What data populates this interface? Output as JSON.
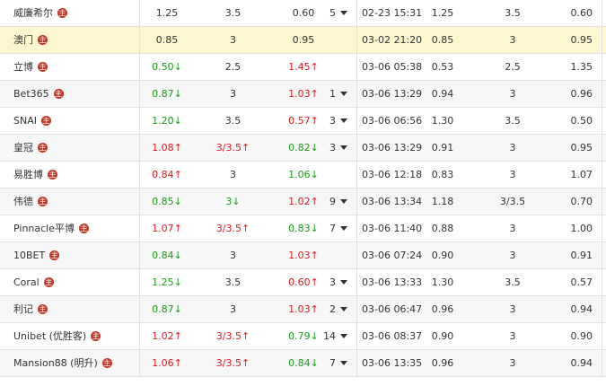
{
  "rows": [
    {
      "name": "威廉希尔",
      "o1": "1.25",
      "o1_dir": "neutral",
      "o2": "3.5",
      "o2_dir": "neutral",
      "o3": "0.60",
      "o3_dir": "neutral",
      "changes": "5",
      "time": "02-23 15:31",
      "n1": "1.25",
      "n2": "3.5",
      "n3": "0.60",
      "style": "normal"
    },
    {
      "name": "澳门",
      "o1": "0.85",
      "o1_dir": "neutral",
      "o2": "3",
      "o2_dir": "neutral",
      "o3": "0.95",
      "o3_dir": "neutral",
      "changes": "",
      "time": "03-02 21:20",
      "n1": "0.85",
      "n2": "3",
      "n3": "0.95",
      "style": "highlight"
    },
    {
      "name": "立博",
      "o1": "0.50↓",
      "o1_dir": "down",
      "o2": "2.5",
      "o2_dir": "neutral",
      "o3": "1.45↑",
      "o3_dir": "up",
      "changes": "",
      "time": "03-06 05:38",
      "n1": "0.53",
      "n2": "2.5",
      "n3": "1.35",
      "style": "normal"
    },
    {
      "name": "Bet365",
      "o1": "0.87↓",
      "o1_dir": "down",
      "o2": "3",
      "o2_dir": "neutral",
      "o3": "1.03↑",
      "o3_dir": "up",
      "changes": "1",
      "time": "03-06 13:29",
      "n1": "0.94",
      "n2": "3",
      "n3": "0.96",
      "style": "alt"
    },
    {
      "name": "SNAI",
      "o1": "1.20↓",
      "o1_dir": "down",
      "o2": "3.5",
      "o2_dir": "neutral",
      "o3": "0.57↑",
      "o3_dir": "up",
      "changes": "3",
      "time": "03-06 06:56",
      "n1": "1.30",
      "n2": "3.5",
      "n3": "0.50",
      "style": "normal"
    },
    {
      "name": "皇冠",
      "o1": "1.08↑",
      "o1_dir": "up",
      "o2": "3/3.5↑",
      "o2_dir": "up",
      "o3": "0.82↓",
      "o3_dir": "down",
      "changes": "3",
      "time": "03-06 13:29",
      "n1": "0.91",
      "n2": "3",
      "n3": "0.95",
      "style": "alt"
    },
    {
      "name": "易胜博",
      "o1": "0.84↑",
      "o1_dir": "up",
      "o2": "3",
      "o2_dir": "neutral",
      "o3": "1.06↓",
      "o3_dir": "down",
      "changes": "",
      "time": "03-06 12:18",
      "n1": "0.83",
      "n2": "3",
      "n3": "1.07",
      "style": "normal"
    },
    {
      "name": "伟德",
      "o1": "0.85↓",
      "o1_dir": "down",
      "o2": "3↓",
      "o2_dir": "down",
      "o3": "1.02↑",
      "o3_dir": "up",
      "changes": "9",
      "time": "03-06 13:34",
      "n1": "1.18",
      "n2": "3/3.5",
      "n3": "0.70",
      "style": "alt"
    },
    {
      "name": "Pinnacle平博",
      "o1": "1.07↑",
      "o1_dir": "up",
      "o2": "3/3.5↑",
      "o2_dir": "up",
      "o3": "0.83↓",
      "o3_dir": "down",
      "changes": "7",
      "time": "03-06 11:40",
      "n1": "0.88",
      "n2": "3",
      "n3": "1.00",
      "style": "normal"
    },
    {
      "name": "10BET",
      "o1": "0.84↓",
      "o1_dir": "down",
      "o2": "3",
      "o2_dir": "neutral",
      "o3": "1.03↑",
      "o3_dir": "up",
      "changes": "",
      "time": "03-06 07:24",
      "n1": "0.90",
      "n2": "3",
      "n3": "0.91",
      "style": "alt"
    },
    {
      "name": "Coral",
      "o1": "1.25↓",
      "o1_dir": "down",
      "o2": "3.5",
      "o2_dir": "neutral",
      "o3": "0.60↑",
      "o3_dir": "up",
      "changes": "3",
      "time": "03-06 13:33",
      "n1": "1.30",
      "n2": "3.5",
      "n3": "0.57",
      "style": "normal"
    },
    {
      "name": "利记",
      "o1": "0.87↓",
      "o1_dir": "down",
      "o2": "3",
      "o2_dir": "neutral",
      "o3": "1.03↑",
      "o3_dir": "up",
      "changes": "2",
      "time": "03-06 06:47",
      "n1": "0.96",
      "n2": "3",
      "n3": "0.94",
      "style": "alt"
    },
    {
      "name": "Unibet (优胜客)",
      "o1": "1.02↑",
      "o1_dir": "up",
      "o2": "3/3.5↑",
      "o2_dir": "up",
      "o3": "0.79↓",
      "o3_dir": "down",
      "changes": "14",
      "time": "03-06 08:37",
      "n1": "0.90",
      "n2": "3",
      "n3": "0.90",
      "style": "normal"
    },
    {
      "name": "Mansion88 (明升)",
      "o1": "1.06↑",
      "o1_dir": "up",
      "o2": "3/3.5↑",
      "o2_dir": "up",
      "o3": "0.84↓",
      "o3_dir": "down",
      "changes": "7",
      "time": "03-06 13:35",
      "n1": "0.96",
      "n2": "3",
      "n3": "0.94",
      "style": "alt"
    }
  ],
  "badge_glyph": "主",
  "colors": {
    "up": "#e0191f",
    "down": "#1d9a1d",
    "highlight": "#fdf7cf",
    "alt": "#f7f7f7"
  },
  "icons": {
    "badge": "home-badge-icon",
    "dropdown": "caret-down-icon"
  }
}
